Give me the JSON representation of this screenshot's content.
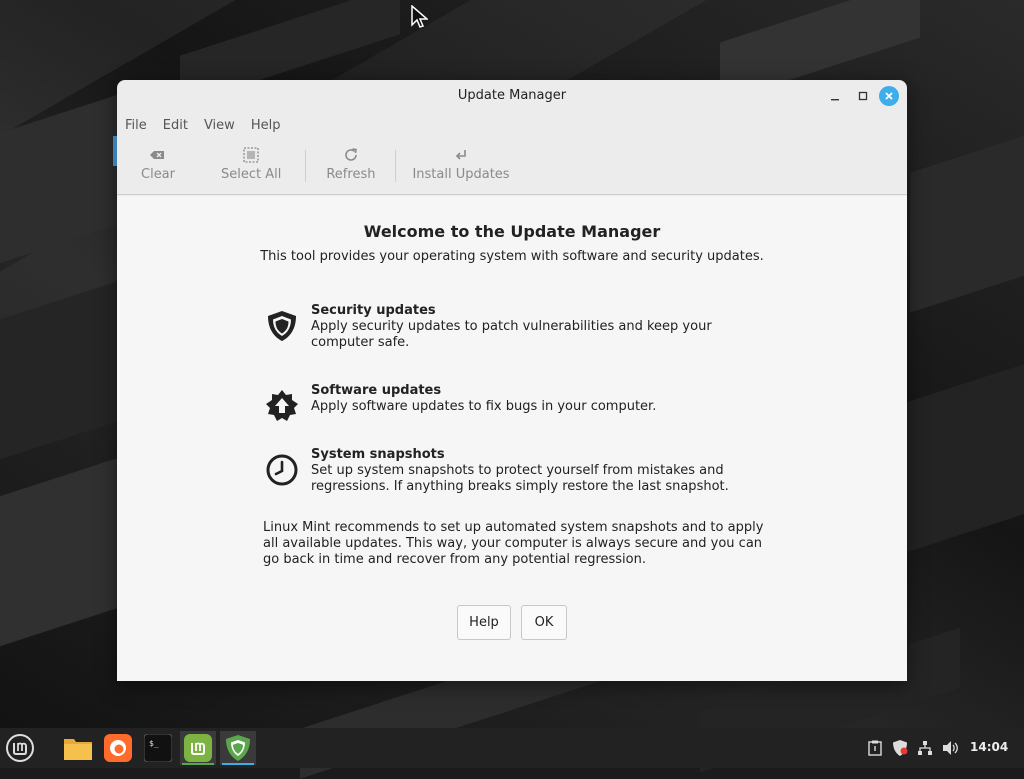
{
  "window": {
    "title": "Update Manager",
    "menu": [
      "File",
      "Edit",
      "View",
      "Help"
    ],
    "toolbar": {
      "clear": "Clear",
      "select_all": "Select All",
      "refresh": "Refresh",
      "install": "Install Updates"
    }
  },
  "dialog": {
    "title": "Welcome to the Update Manager",
    "subtitle": "This tool provides your operating system with software and security updates.",
    "features": [
      {
        "title": "Security updates",
        "desc": "Apply security updates to patch vulnerabilities and keep your computer safe.",
        "icon": "shield-icon"
      },
      {
        "title": "Software updates",
        "desc": "Apply software updates to fix bugs in your computer.",
        "icon": "update-star-icon"
      },
      {
        "title": "System snapshots",
        "desc": "Set up system snapshots to protect yourself from mistakes and regressions. If anything breaks simply restore the last snapshot.",
        "icon": "clock-icon"
      }
    ],
    "recommendation": "Linux Mint recommends to set up automated system snapshots and to apply all available updates. This way, your computer is always secure and you can go back in time and recover from any potential regression.",
    "help_button": "Help",
    "ok_button": "OK"
  },
  "taskbar": {
    "clock": "14:04",
    "apps": [
      "mint-menu-icon",
      "files-icon",
      "firefox-icon",
      "terminal-icon",
      "mintinstall-icon",
      "update-manager-icon"
    ],
    "tray": [
      "clipboard-icon",
      "update-shield-icon",
      "network-icon",
      "volume-icon"
    ]
  },
  "colors": {
    "accent": "#3daee9",
    "mint_green": "#5aa64c"
  }
}
